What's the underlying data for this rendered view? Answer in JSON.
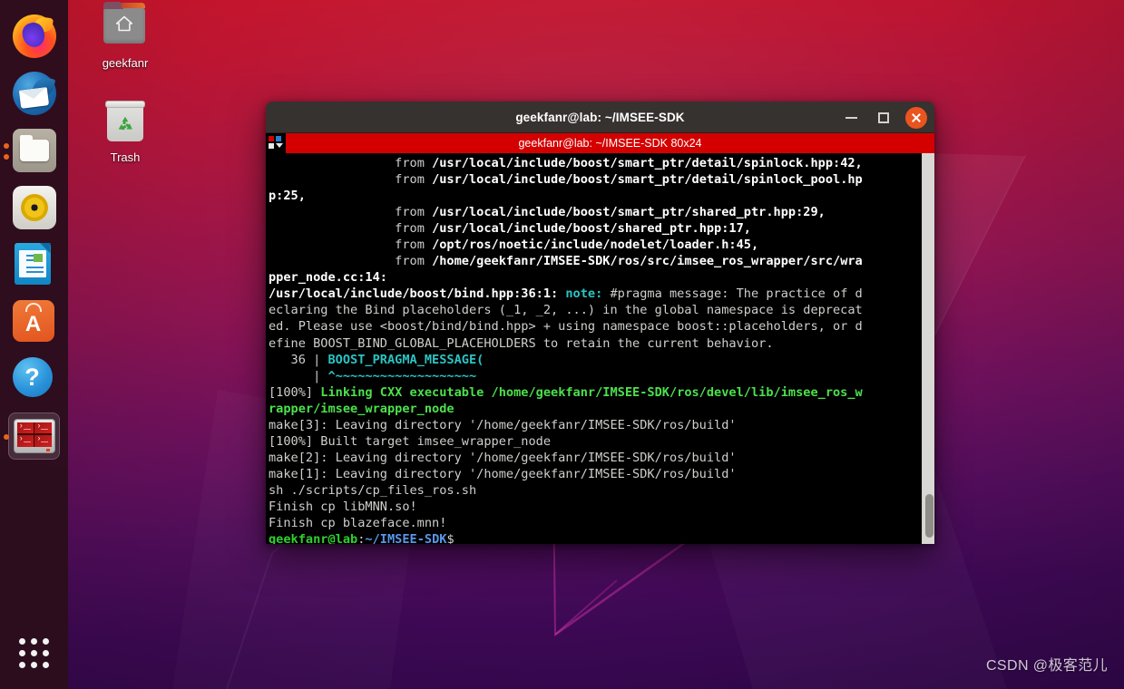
{
  "desktop": {
    "wallpaper_top_color": "#c7152c",
    "wallpaper_bottom_color": "#350751",
    "icons": [
      {
        "name": "home-folder",
        "label": "geekfanr",
        "icon": "home-folder-icon"
      },
      {
        "name": "trash",
        "label": "Trash",
        "icon": "trash-icon"
      }
    ],
    "watermark": "CSDN @极客范儿"
  },
  "dock": {
    "background_color": "#2b0e1c",
    "items": [
      {
        "name": "firefox",
        "label": "Firefox",
        "icon": "firefox-icon",
        "running": false,
        "selected": false
      },
      {
        "name": "thunderbird",
        "label": "Thunderbird Mail",
        "icon": "thunderbird-icon",
        "running": false,
        "selected": false
      },
      {
        "name": "files",
        "label": "Files",
        "icon": "files-icon",
        "running": true,
        "dots": 2,
        "selected": false
      },
      {
        "name": "rhythmbox",
        "label": "Rhythmbox",
        "icon": "rhythmbox-icon",
        "running": false,
        "selected": false
      },
      {
        "name": "libreoffice-writer",
        "label": "LibreOffice Writer",
        "icon": "document-icon",
        "running": false,
        "selected": false
      },
      {
        "name": "ubuntu-software",
        "label": "Ubuntu Software",
        "icon": "software-bag-icon",
        "running": false,
        "selected": false
      },
      {
        "name": "help",
        "label": "Help",
        "icon": "question-mark-icon",
        "running": false,
        "selected": false
      },
      {
        "name": "terminal",
        "label": "Terminal",
        "icon": "terminal-icon",
        "running": true,
        "dots": 1,
        "selected": true
      }
    ],
    "show_applications_label": "Show Applications"
  },
  "window": {
    "title": "geekfanr@lab: ~/IMSEE-SDK",
    "title_bar_color": "#363230",
    "buttons": {
      "minimize": "minimize-button",
      "maximize": "maximize-button",
      "close": "close-button"
    },
    "tab": {
      "label": "geekfanr@lab: ~/IMSEE-SDK 80x24",
      "bar_color": "#d40000",
      "size": "80x24"
    },
    "scrollbar": {
      "track_color": "#d9d7d3",
      "thumb_color": "#8f8d88"
    }
  },
  "terminal": {
    "background_color": "#000000",
    "foreground_color": "#d0cfcc",
    "prompt": {
      "user_host": "geekfanr@lab",
      "separator": ":",
      "path": "~/IMSEE-SDK",
      "symbol": "$",
      "user_host_color": "#2fd12f",
      "path_color": "#5a95ea"
    },
    "lines": [
      {
        "segments": [
          {
            "text": "                 ",
            "cls": "tan"
          },
          {
            "text": "from ",
            "cls": "gray"
          },
          {
            "text": "/usr/local/include/boost/smart_ptr/detail/spinlock.hpp:42,",
            "cls": "bold white"
          }
        ]
      },
      {
        "segments": [
          {
            "text": "                 ",
            "cls": "tan"
          },
          {
            "text": "from ",
            "cls": "gray"
          },
          {
            "text": "/usr/local/include/boost/smart_ptr/detail/spinlock_pool.hp",
            "cls": "bold white"
          }
        ]
      },
      {
        "segments": [
          {
            "text": "p:25,",
            "cls": "bold white"
          }
        ]
      },
      {
        "segments": [
          {
            "text": "                 ",
            "cls": "tan"
          },
          {
            "text": "from ",
            "cls": "gray"
          },
          {
            "text": "/usr/local/include/boost/smart_ptr/shared_ptr.hpp:29,",
            "cls": "bold white"
          }
        ]
      },
      {
        "segments": [
          {
            "text": "                 ",
            "cls": "tan"
          },
          {
            "text": "from ",
            "cls": "gray"
          },
          {
            "text": "/usr/local/include/boost/shared_ptr.hpp:17,",
            "cls": "bold white"
          }
        ]
      },
      {
        "segments": [
          {
            "text": "                 ",
            "cls": "tan"
          },
          {
            "text": "from ",
            "cls": "gray"
          },
          {
            "text": "/opt/ros/noetic/include/nodelet/loader.h:45,",
            "cls": "bold white"
          }
        ]
      },
      {
        "segments": [
          {
            "text": "                 ",
            "cls": "tan"
          },
          {
            "text": "from ",
            "cls": "gray"
          },
          {
            "text": "/home/geekfanr/IMSEE-SDK/ros/src/imsee_ros_wrapper/src/wra",
            "cls": "bold white"
          }
        ]
      },
      {
        "segments": [
          {
            "text": "pper_node.cc:14:",
            "cls": "bold white"
          }
        ]
      },
      {
        "segments": [
          {
            "text": "/usr/local/include/boost/bind.hpp:36:1: ",
            "cls": "bold white"
          },
          {
            "text": "note: ",
            "cls": "bold cyan"
          },
          {
            "text": "#pragma message: The practice of d",
            "cls": "tan"
          }
        ]
      },
      {
        "segments": [
          {
            "text": "eclaring the Bind placeholders (_1, _2, ...) in the global namespace is deprecat",
            "cls": "tan"
          }
        ]
      },
      {
        "segments": [
          {
            "text": "ed. Please use <boost/bind/bind.hpp> + using namespace boost::placeholders, or d",
            "cls": "tan"
          }
        ]
      },
      {
        "segments": [
          {
            "text": "efine BOOST_BIND_GLOBAL_PLACEHOLDERS to retain the current behavior.",
            "cls": "tan"
          }
        ]
      },
      {
        "segments": [
          {
            "text": "   36 | ",
            "cls": "tan"
          },
          {
            "text": "BOOST_PRAGMA_MESSAGE(",
            "cls": "bold cyan"
          }
        ]
      },
      {
        "segments": [
          {
            "text": "      | ",
            "cls": "tan"
          },
          {
            "text": "^~~~~~~~~~~~~~~~~~~~",
            "cls": "bold cyan"
          }
        ]
      },
      {
        "segments": [
          {
            "text": "[100%] ",
            "cls": "tan"
          },
          {
            "text": "Linking CXX executable /home/geekfanr/IMSEE-SDK/ros/devel/lib/imsee_ros_w",
            "cls": "bold pgreen"
          }
        ]
      },
      {
        "segments": [
          {
            "text": "rapper/imsee_wrapper_node",
            "cls": "bold pgreen"
          }
        ]
      },
      {
        "segments": [
          {
            "text": "make[3]: Leaving directory '/home/geekfanr/IMSEE-SDK/ros/build'",
            "cls": "tan"
          }
        ]
      },
      {
        "segments": [
          {
            "text": "[100%] Built target imsee_wrapper_node",
            "cls": "tan"
          }
        ]
      },
      {
        "segments": [
          {
            "text": "make[2]: Leaving directory '/home/geekfanr/IMSEE-SDK/ros/build'",
            "cls": "tan"
          }
        ]
      },
      {
        "segments": [
          {
            "text": "make[1]: Leaving directory '/home/geekfanr/IMSEE-SDK/ros/build'",
            "cls": "tan"
          }
        ]
      },
      {
        "segments": [
          {
            "text": "sh ./scripts/cp_files_ros.sh",
            "cls": "tan"
          }
        ]
      },
      {
        "segments": [
          {
            "text": "Finish cp libMNN.so!",
            "cls": "tan"
          }
        ]
      },
      {
        "segments": [
          {
            "text": "Finish cp blazeface.mnn!",
            "cls": "tan"
          }
        ]
      },
      {
        "segments": [
          {
            "text": "geekfanr@lab",
            "cls": "bold green"
          },
          {
            "text": ":",
            "cls": "tan"
          },
          {
            "text": "~/IMSEE-SDK",
            "cls": "bold blue"
          },
          {
            "text": "$ ",
            "cls": "tan"
          }
        ]
      }
    ]
  }
}
